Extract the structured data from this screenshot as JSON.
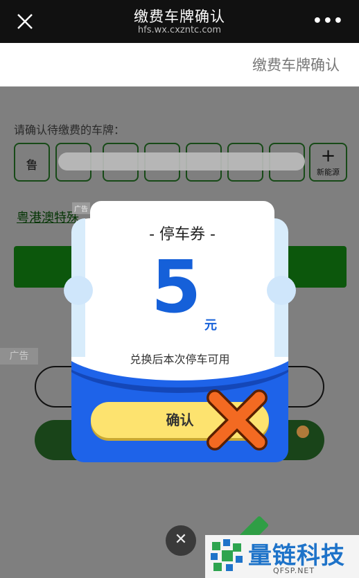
{
  "topbar": {
    "title": "缴费车牌确认",
    "url": "hfs.wx.cxzntc.com",
    "more": "•••"
  },
  "subheader": {
    "title": "缴费车牌确认"
  },
  "plate": {
    "prompt": "请确认待缴费的车牌：",
    "province": "鲁",
    "new_energy_label": "新能源",
    "new_energy_plus": "+"
  },
  "promo": {
    "link_text": "粤港澳特殊",
    "ad_tag": "广告"
  },
  "ad_label": "广告",
  "popup": {
    "title": "- 停车券 -",
    "amount": "5",
    "unit": "元",
    "description": "兑换后本次停车可用",
    "confirm_label": "确认"
  },
  "close_symbol": "✕",
  "watermark": {
    "name": "量链科技",
    "domain": "QFSP.NET"
  },
  "colors": {
    "accent_blue": "#1e63e9",
    "button_yellow": "#fde36f",
    "x_orange": "#f36a22",
    "page_green": "#0c570c"
  }
}
